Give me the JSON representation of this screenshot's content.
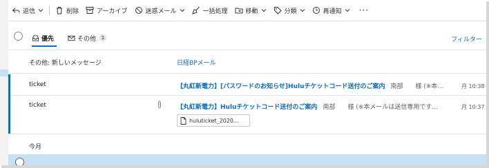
{
  "toolbar": {
    "reply_label": "返信",
    "delete_label": "削除",
    "archive_label": "アーカイブ",
    "junk_label": "迷惑メール",
    "sweep_label": "一括処理",
    "move_label": "移動",
    "categorize_label": "分類",
    "snooze_label": "再通知",
    "more_label": "···"
  },
  "tabs": {
    "focused_label": "優先",
    "other_label": "その他",
    "other_count": "1",
    "filter_label": "フィルター"
  },
  "other_notice": {
    "label": "その他: 新しいメッセージ",
    "sender_link": "日経BPメール"
  },
  "messages": [
    {
      "sender": "ticket",
      "subject": "【丸紅新電力】[パスワードのお知らせ]Huluチケットコード送付のご案内",
      "preview": "南部　　様 (※本…",
      "time": "月 10:38"
    },
    {
      "sender": "ticket",
      "subject": "【丸紅新電力】Huluチケットコード送付のご案内",
      "preview": "南部　　様 (※本メールは送信専用です…",
      "time": "月 10:37",
      "attachment": "huluticket_2020..."
    }
  ],
  "sections": {
    "this_month": "今月"
  }
}
